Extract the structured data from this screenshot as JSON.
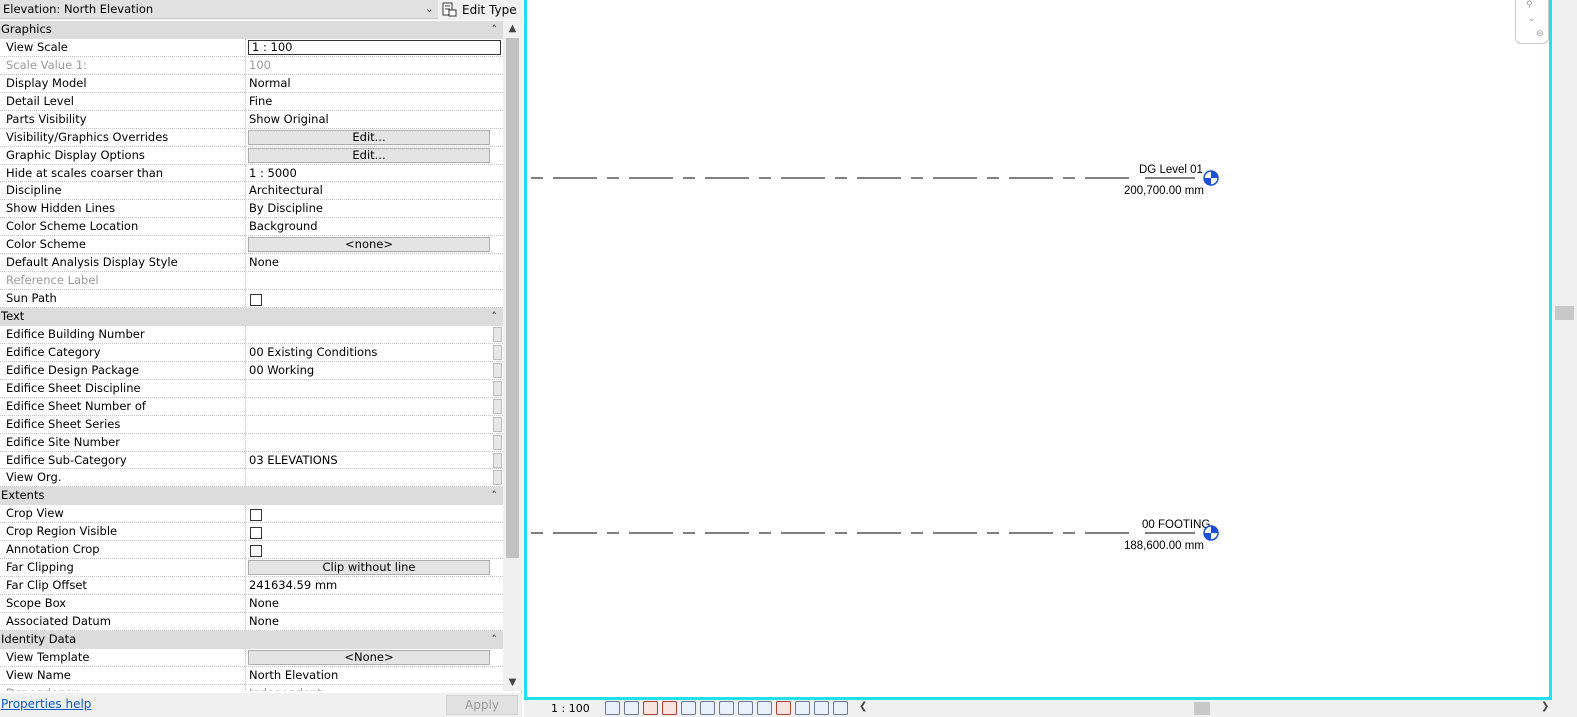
{
  "properties": {
    "type_selector": "Elevation: North Elevation",
    "edit_type_label": "Edit Type",
    "groups": [
      {
        "name": "Graphics",
        "rows": [
          {
            "label": "View Scale",
            "value": "1 : 100",
            "kind": "input"
          },
          {
            "label": "Scale Value    1:",
            "value": "100",
            "kind": "dim"
          },
          {
            "label": "Display Model",
            "value": "Normal"
          },
          {
            "label": "Detail Level",
            "value": "Fine"
          },
          {
            "label": "Parts Visibility",
            "value": "Show Original"
          },
          {
            "label": "Visibility/Graphics Overrides",
            "value": "Edit...",
            "kind": "button"
          },
          {
            "label": "Graphic Display Options",
            "value": "Edit...",
            "kind": "button"
          },
          {
            "label": "Hide at scales coarser than",
            "value": "1 : 5000"
          },
          {
            "label": "Discipline",
            "value": "Architectural"
          },
          {
            "label": "Show Hidden Lines",
            "value": "By Discipline"
          },
          {
            "label": "Color Scheme Location",
            "value": "Background"
          },
          {
            "label": "Color Scheme",
            "value": "<none>",
            "kind": "button"
          },
          {
            "label": "Default Analysis Display Style",
            "value": "None"
          },
          {
            "label": "Reference Label",
            "value": "",
            "kind": "dim"
          },
          {
            "label": "Sun Path",
            "value": "",
            "kind": "checkbox"
          }
        ]
      },
      {
        "name": "Text",
        "rows": [
          {
            "label": "Edifice Building Number",
            "value": "",
            "kind": "side"
          },
          {
            "label": "Edifice Category",
            "value": "00 Existing Conditions",
            "kind": "side"
          },
          {
            "label": "Edifice Design Package",
            "value": "00 Working",
            "kind": "side"
          },
          {
            "label": "Edifice Sheet Discipline",
            "value": "",
            "kind": "side"
          },
          {
            "label": "Edifice Sheet Number of",
            "value": "",
            "kind": "side"
          },
          {
            "label": "Edifice Sheet Series",
            "value": "",
            "kind": "side"
          },
          {
            "label": "Edifice Site Number",
            "value": "",
            "kind": "side"
          },
          {
            "label": "Edifice Sub-Category",
            "value": "03 ELEVATIONS",
            "kind": "side"
          },
          {
            "label": "View Org.",
            "value": "",
            "kind": "side"
          }
        ]
      },
      {
        "name": "Extents",
        "rows": [
          {
            "label": "Crop View",
            "value": "",
            "kind": "checkbox"
          },
          {
            "label": "Crop Region Visible",
            "value": "",
            "kind": "checkbox"
          },
          {
            "label": "Annotation Crop",
            "value": "",
            "kind": "checkbox"
          },
          {
            "label": "Far Clipping",
            "value": "Clip without line",
            "kind": "button"
          },
          {
            "label": "Far Clip Offset",
            "value": "241634.59 mm"
          },
          {
            "label": "Scope Box",
            "value": "None"
          },
          {
            "label": "Associated Datum",
            "value": "None"
          }
        ]
      },
      {
        "name": "Identity Data",
        "rows": [
          {
            "label": "View Template",
            "value": "<None>",
            "kind": "button"
          },
          {
            "label": "View Name",
            "value": "North Elevation"
          },
          {
            "label": "Dependency",
            "value": "Independent",
            "kind": "dim"
          }
        ]
      }
    ],
    "help_link": "Properties help",
    "apply_label": "Apply"
  },
  "view": {
    "levels": [
      {
        "name": "DG Level 01",
        "elevation": "200,700.00 mm"
      },
      {
        "name": "00 FOOTING",
        "elevation": "188,600.00 mm"
      }
    ],
    "accent_color": "#1fe0ec",
    "level_head_color": "#1a4fd6"
  },
  "view_control_bar": {
    "scale": "1 : 100",
    "icons": [
      "detail-level-icon",
      "visual-style-icon",
      "sun-path-icon",
      "shadows-icon",
      "render-icon",
      "crop-view-icon",
      "crop-region-icon",
      "unlock-3d-icon",
      "temporary-hide-icon",
      "reveal-hidden-icon",
      "worksharing-icon",
      "analysis-display-icon",
      "constraints-icon"
    ]
  }
}
